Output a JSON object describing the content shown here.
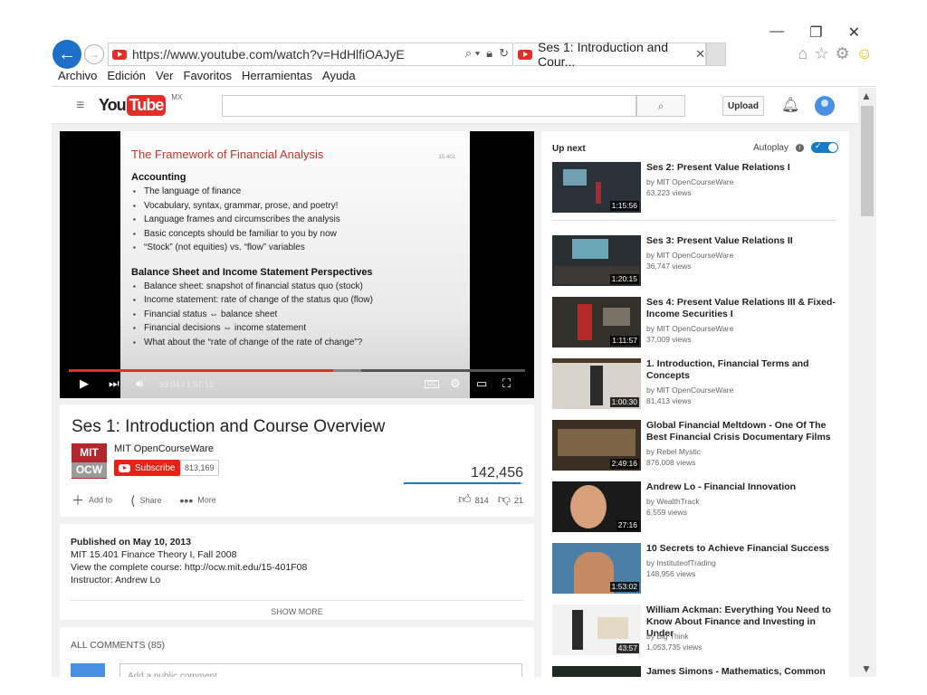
{
  "browser": {
    "url": "https://www.youtube.com/watch?v=HdHlfiOAJyE",
    "tab_title": "Ses 1: Introduction and Cour...",
    "menu": [
      "Archivo",
      "Edición",
      "Ver",
      "Favoritos",
      "Herramientas",
      "Ayuda"
    ]
  },
  "masthead": {
    "logo_you": "You",
    "logo_tube": "Tube",
    "region": "MX",
    "search_placeholder": "",
    "upload_label": "Upload"
  },
  "slide": {
    "title": "The Framework of Financial Analysis",
    "course_code": "15.401",
    "sections": [
      {
        "heading": "Accounting",
        "bullets": [
          "The language of finance",
          "Vocabulary, syntax, grammar, prose, and poetry!",
          "Language frames and circumscribes the analysis",
          "Basic concepts should be familiar to you by now",
          "“Stock” (not equities) vs. “flow” variables"
        ]
      },
      {
        "heading": "Balance Sheet and Income Statement Perspectives",
        "bullets": [
          "Balance sheet: snapshot of financial status quo (stock)",
          "Income statement: rate of change of the status quo (flow)",
          "Financial status ⇔ balance sheet",
          "Financial decisions ⇔ income statement",
          "What about the “rate of change of the rate of change”?"
        ]
      }
    ]
  },
  "player": {
    "current_time": "39:04",
    "duration": "1:07:12",
    "time_display": "39:04 / 1:07:12",
    "played_fraction": 0.58,
    "buffered_fraction": 0.64,
    "cc_label": "CC"
  },
  "video": {
    "title": "Ses 1: Introduction and Course Overview",
    "channel": "MIT OpenCourseWare",
    "channel_logo_top": "MIT",
    "channel_logo_bottom": "OCW",
    "subscribe_label": "Subscribe",
    "subscriber_count": "813,169",
    "view_count": "142,456",
    "likes": "814",
    "dislikes": "21",
    "like_fraction": 0.975,
    "actions": {
      "add_to": "Add to",
      "share": "Share",
      "more": "More"
    }
  },
  "description": {
    "published": "Published on May 10, 2013",
    "lines": [
      "MIT 15.401 Finance Theory I, Fall 2008",
      "View the complete course: http://ocw.mit.edu/15-401F08",
      "Instructor: Andrew Lo"
    ],
    "show_more": "SHOW MORE"
  },
  "comments": {
    "header": "ALL COMMENTS (85)",
    "placeholder": "Add a public comment..."
  },
  "sidebar": {
    "up_next": "Up next",
    "autoplay": "Autoplay",
    "videos": [
      {
        "title": "Ses 2: Present Value Relations I",
        "channel": "by MIT OpenCourseWare",
        "views": "63,223 views",
        "duration": "1:15:56"
      },
      {
        "title": "Ses 3: Present Value Relations II",
        "channel": "by MIT OpenCourseWare",
        "views": "36,747 views",
        "duration": "1:20:15"
      },
      {
        "title": "Ses 4: Present Value Relations III & Fixed-Income Securities I",
        "channel": "by MIT OpenCourseWare",
        "views": "37,009 views",
        "duration": "1:11:57"
      },
      {
        "title": "1. Introduction, Financial Terms and Concepts",
        "channel": "by MIT OpenCourseWare",
        "views": "81,413 views",
        "duration": "1:00:30"
      },
      {
        "title": "Global Financial Meltdown - One Of The Best Financial Crisis Documentary Films",
        "channel": "by Rebel Mystic",
        "views": "876,008 views",
        "duration": "2:49:16"
      },
      {
        "title": "Andrew Lo - Financial Innovation",
        "channel": "by WealthTrack",
        "views": "6,559 views",
        "duration": "27:16"
      },
      {
        "title": "10 Secrets to Achieve Financial Success",
        "channel": "by InstituteofTrading",
        "views": "148,956 views",
        "duration": "1:53:02"
      },
      {
        "title": "William Ackman: Everything You Need to Know About Finance and Investing in Under",
        "channel": "by Big Think",
        "views": "1,053,735 views",
        "duration": "43:57"
      },
      {
        "title": "James Simons - Mathematics, Common",
        "channel": "",
        "views": "",
        "duration": ""
      }
    ]
  }
}
